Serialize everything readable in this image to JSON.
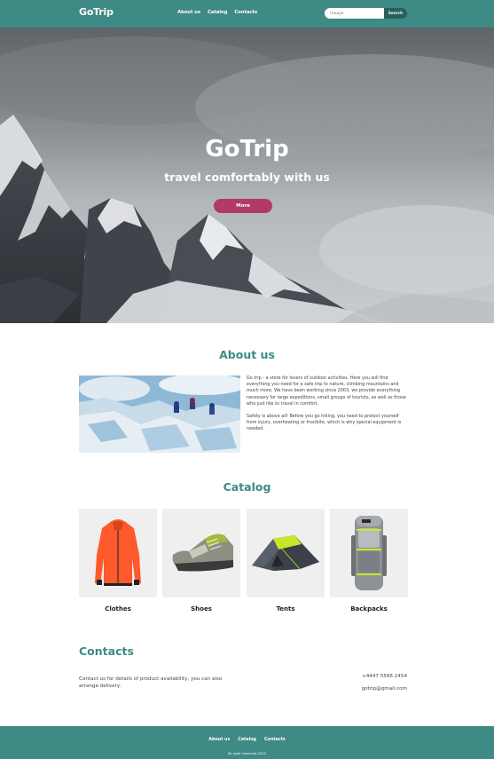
{
  "header": {
    "logo": "GoTrip",
    "nav": [
      "About us",
      "Catalog",
      "Contacts"
    ],
    "search": {
      "placeholder": "Пошук",
      "button_label": "Search"
    }
  },
  "hero": {
    "title": "GoTrip",
    "subtitle": "travel comfortably with us",
    "button_label": "More"
  },
  "about": {
    "title": "About us",
    "paragraphs": [
      "Go trip - a store for lovers of outdoor activities. Here you will find everything you need for a safe trip to nature, climbing mountains and much more. We have been working since 2003, we provide everything necessary for large expeditions, small groups of tourists, as well as those who just like to travel in comfort.",
      "Safety is above all! Before you go hiking, you need to protect yourself from injury, overheating or frostbite, which is why special equipment is needed."
    ]
  },
  "catalog": {
    "title": "Catalog",
    "items": [
      {
        "label": "Clothes",
        "icon": "jacket-icon"
      },
      {
        "label": "Shoes",
        "icon": "hiking-shoe-icon"
      },
      {
        "label": "Tents",
        "icon": "tent-icon"
      },
      {
        "label": "Backpacks",
        "icon": "backpack-icon"
      }
    ]
  },
  "contacts": {
    "title": "Contacts",
    "text": "Contact us for details of product availability, you can also arrange delivery.",
    "phone": "+4447 5566 2454",
    "email": "gotrip@gmail.com"
  },
  "footer": {
    "nav": [
      "About us",
      "Catalog",
      "Contacts"
    ],
    "copyright": "All right reserved 2022"
  },
  "colors": {
    "brand": "#3e8a84",
    "accent": "#b33a64",
    "search_button": "#2b5f5b"
  }
}
